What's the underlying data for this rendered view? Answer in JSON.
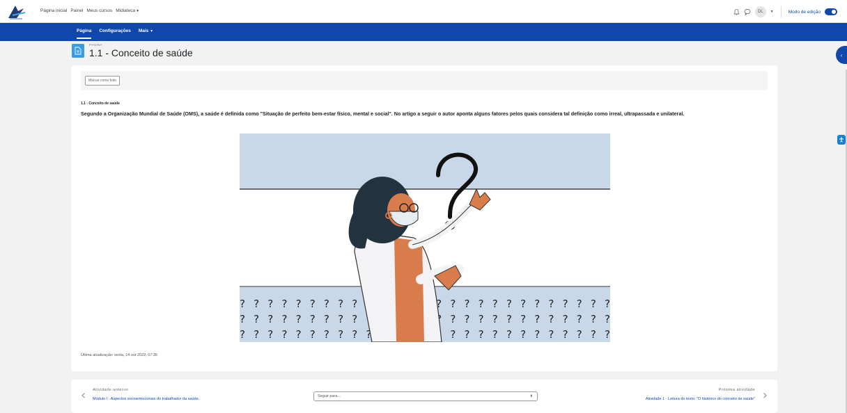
{
  "topbar": {
    "nav": [
      "Página inicial",
      "Painel",
      "Meus cursos",
      "Midiateca"
    ],
    "avatar_initials": "DL",
    "edit_mode_label": "Modo de edição"
  },
  "secondary_nav": {
    "items": [
      "Página",
      "Configurações",
      "Mais"
    ]
  },
  "header": {
    "type_label": "PÁGINA",
    "title": "1.1 - Conceito de saúde"
  },
  "content": {
    "mark_done": "Marcar como feito",
    "heading": "1.1 - Conceito de saúde",
    "text": "Segundo a Organização Mundial de Saúde (OMS), a saúde é definida como \"Situação de perfeito bem-estar físico, mental e social\". No artigo a seguir o autor aponta alguns fatores pelos quais considera tal definição como irreal, ultrapassada e unilateral.",
    "last_update": "Última atualização: sexta, 14 out 2022, 07:35"
  },
  "activity_nav": {
    "prev_caption": "Atividade anterior",
    "prev_link": "Módulo I - Aspectos socioemocionais do trabalhador da saúde.",
    "jump_placeholder": "Seguir para...",
    "next_caption": "Próxima atividade",
    "next_link": "Atividade 1 - Leitura do texto: \"O histórico do conceito de saúde\""
  },
  "colors": {
    "brand": "#0f47ad",
    "page_icon": "#399be2",
    "illustration_sky": "#c9d8e8"
  }
}
